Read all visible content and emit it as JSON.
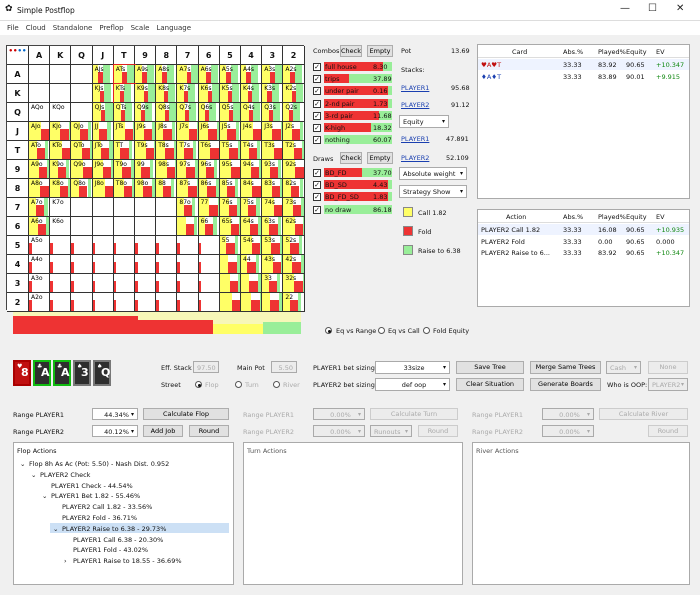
{
  "window": {
    "title": "Simple Postflop"
  },
  "menu": [
    "File",
    "Cloud",
    "Standalone",
    "Preflop",
    "Scale",
    "Language"
  ],
  "grid": {
    "ranks": [
      "A",
      "K",
      "Q",
      "J",
      "T",
      "9",
      "8",
      "7",
      "6",
      "5",
      "4",
      "3",
      "2"
    ],
    "rows": [
      [
        "",
        "",
        "",
        "AJs",
        "ATs",
        "A9s",
        "A8s",
        "A7s",
        "A6s",
        "A5s",
        "A4s",
        "A3s",
        "A2s"
      ],
      [
        "",
        "",
        "",
        "KJs",
        "KTs",
        "K9s",
        "K8s",
        "K7s",
        "K6s",
        "K5s",
        "K4s",
        "K3s",
        "K2s"
      ],
      [
        "AQo",
        "KQo",
        "",
        "QJs",
        "QTs",
        "Q9s",
        "Q8s",
        "Q7s",
        "Q6s",
        "Q5s",
        "Q4s",
        "Q3s",
        "Q2s"
      ],
      [
        "AJo",
        "KJo",
        "QJo",
        "JJ",
        "JTs",
        "J9s",
        "J8s",
        "J7s",
        "J6s",
        "J5s",
        "J4s",
        "J3s",
        "J2s"
      ],
      [
        "ATo",
        "KTo",
        "QTo",
        "JTo",
        "TT",
        "T9s",
        "T8s",
        "T7s",
        "T6s",
        "T5s",
        "T4s",
        "T3s",
        "T2s"
      ],
      [
        "A9o",
        "K9o",
        "Q9o",
        "J9o",
        "T9o",
        "99",
        "98s",
        "97s",
        "96s",
        "95s",
        "94s",
        "93s",
        "92s"
      ],
      [
        "A8o",
        "K8o",
        "Q8o",
        "J8o",
        "T8o",
        "98o",
        "88",
        "87s",
        "86s",
        "85s",
        "84s",
        "83s",
        "82s"
      ],
      [
        "A7o",
        "K7o",
        "",
        "",
        "",
        "",
        "",
        "87o",
        "77",
        "76s",
        "75s",
        "74s",
        "73s"
      ],
      [
        "A6o",
        "K6o",
        "",
        "",
        "",
        "",
        "",
        "",
        "66",
        "65s",
        "64s",
        "63s",
        "62s"
      ],
      [
        "A5o",
        "",
        "",
        "",
        "",
        "",
        "",
        "",
        "",
        "55",
        "54s",
        "53s",
        "52s"
      ],
      [
        "A4o",
        "",
        "",
        "",
        "",
        "",
        "",
        "",
        "",
        "",
        "44",
        "43s",
        "42s"
      ],
      [
        "A3o",
        "",
        "",
        "",
        "",
        "",
        "",
        "",
        "",
        "",
        "",
        "33",
        "32s"
      ],
      [
        "A2o",
        "",
        "",
        "",
        "",
        "",
        "",
        "",
        "",
        "",
        "",
        "",
        "22"
      ]
    ]
  },
  "combos": {
    "header": "Combos",
    "check": "Check",
    "empty": "Empty",
    "rows": [
      {
        "label": "full house",
        "value": "8.30"
      },
      {
        "label": "trips",
        "value": "37.89"
      },
      {
        "label": "under pair",
        "value": "0.16"
      },
      {
        "label": "2-nd pair",
        "value": "1.73"
      },
      {
        "label": "3-rd pair",
        "value": "11.68"
      },
      {
        "label": "K-high",
        "value": "18.32"
      },
      {
        "label": "nothing",
        "value": "60.07"
      }
    ]
  },
  "draws": {
    "header": "Draws",
    "check": "Check",
    "empty": "Empty",
    "rows": [
      {
        "label": "BD_FD",
        "value": "37.70"
      },
      {
        "label": "BD_SD",
        "value": "4.43"
      },
      {
        "label": "BD_FD_SD",
        "value": "1.83"
      },
      {
        "label": "no draw",
        "value": "86.18"
      }
    ]
  },
  "pot": {
    "label": "Pot",
    "value": "13.69"
  },
  "stacks": {
    "label": "Stacks:",
    "p1": "PLAYER1",
    "p1v": "95.68",
    "p2": "PLAYER2",
    "p2v": "91.12"
  },
  "equity_select": "Equity",
  "equity": {
    "p1": "PLAYER1",
    "p1v": "47.891",
    "p2": "PLAYER2",
    "p2v": "52.109"
  },
  "weight_select": "Absolute weight",
  "strategy_select": "Strategy Show",
  "legend": [
    {
      "label": "Call 1.82",
      "color": "#ffff66"
    },
    {
      "label": "Fold",
      "color": "#ee3333"
    },
    {
      "label": "Raise to 6.38",
      "color": "#99ee99"
    }
  ],
  "card_table": {
    "headers": [
      "Card",
      "Abs.%",
      "Played%",
      "Equity",
      "EV"
    ],
    "rows": [
      {
        "card": "♥A♥T",
        "abs": "33.33",
        "played": "83.92",
        "equity": "90.65",
        "ev": "+10.347"
      },
      {
        "card": "♦A♦T",
        "abs": "33.33",
        "played": "83.89",
        "equity": "90.01",
        "ev": "+9.915"
      }
    ]
  },
  "action_table": {
    "headers": [
      "Action",
      "Abs.%",
      "Played%",
      "Equity",
      "EV"
    ],
    "rows": [
      {
        "action": "PLAYER2 Call 1.82",
        "abs": "33.33",
        "played": "16.08",
        "equity": "90.65",
        "ev": "+10.935"
      },
      {
        "action": "PLAYER2 Fold",
        "abs": "33.33",
        "played": "0.00",
        "equity": "90.65",
        "ev": "0.000"
      },
      {
        "action": "PLAYER2 Raise to 6...",
        "abs": "33.33",
        "played": "83.92",
        "equity": "90.65",
        "ev": "+10.347"
      }
    ]
  },
  "eq_mode": [
    "Eq vs Range",
    "Eq vs Call",
    "Fold Equity"
  ],
  "board": [
    {
      "rank": "8",
      "suit": "♥",
      "color": "#c01010",
      "border": "#aa0000"
    },
    {
      "rank": "A",
      "suit": "♣",
      "color": "#2e2e2e",
      "border": "#11bb11"
    },
    {
      "rank": "A",
      "suit": "♣",
      "color": "#2e2e2e",
      "border": "#11bb11"
    },
    {
      "rank": "3",
      "suit": "♠",
      "color": "#2e2e2e",
      "border": "#777"
    },
    {
      "rank": "Q",
      "suit": "♠",
      "color": "#2e2e2e",
      "border": "#777"
    }
  ],
  "eff_stack": {
    "label": "Eff. Stack",
    "value": "97.50"
  },
  "main_pot": {
    "label": "Main Pot",
    "value": "5.50"
  },
  "street": {
    "label": "Street",
    "options": [
      "Flop",
      "Turn",
      "River"
    ]
  },
  "bet_sizing": {
    "p1_label": "PLAYER1 bet sizing:",
    "p1_value": "33size",
    "p2_label": "PLAYER2 bet sizing:",
    "p2_value": "def oop"
  },
  "buttons": {
    "save_tree": "Save Tree",
    "merge": "Merge Same Trees",
    "cash": "Cash",
    "none": "None",
    "clear": "Clear Situation",
    "generate": "Generate Boards",
    "who_oop": "Who is OOP:",
    "oop_value": "PLAYER2"
  },
  "ranges": {
    "p1_label": "Range PLAYER1",
    "p1_value": "44.34%",
    "calc_flop": "Calculate Flop",
    "p2_label": "Range PLAYER2",
    "p2_value": "40.12%",
    "add_job": "Add Job",
    "round": "Round",
    "turn_p1": "Range PLAYER1",
    "turn_p1v": "0.00%",
    "calc_turn": "Calculate Turn",
    "turn_p2": "Range PLAYER2",
    "turn_p2v": "0.00%",
    "runouts": "Runouts",
    "round2": "Round",
    "river_p1": "Range PLAYER1",
    "river_p1v": "0.00%",
    "calc_river": "Calculate River",
    "river_p2": "Range PLAYER2",
    "river_p2v": "0.00%",
    "round3": "Round"
  },
  "flop_actions": {
    "title": "Flop Actions",
    "nodes": [
      {
        "text": "Flop 8h As Ac (Pot: 5.50) - Nash Dist. 0.952",
        "level": 0,
        "arrow": "⌄"
      },
      {
        "text": "PLAYER2 Check",
        "level": 1,
        "arrow": "⌄"
      },
      {
        "text": "PLAYER1 Check - 44.54%",
        "level": 2,
        "arrow": ""
      },
      {
        "text": "PLAYER1 Bet 1.82 - 55.46%",
        "level": 2,
        "arrow": "⌄"
      },
      {
        "text": "PLAYER2 Call 1.82 - 33.56%",
        "level": 3,
        "arrow": ""
      },
      {
        "text": "PLAYER2 Fold - 36.71%",
        "level": 3,
        "arrow": ""
      },
      {
        "text": "PLAYER2 Raise to 6.38 - 29.73%",
        "level": 3,
        "arrow": "⌄"
      },
      {
        "text": "PLAYER1 Call 6.38 - 20.30%",
        "level": 4,
        "arrow": ""
      },
      {
        "text": "PLAYER1 Fold - 43.02%",
        "level": 4,
        "arrow": ""
      },
      {
        "text": "PLAYER1 Raise to 18.55 - 36.69%",
        "level": 4,
        "arrow": "›"
      }
    ]
  },
  "turn_actions": {
    "title": "Turn Actions"
  },
  "river_actions": {
    "title": "River Actions"
  }
}
